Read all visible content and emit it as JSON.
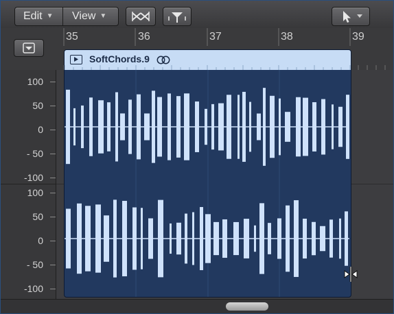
{
  "toolbar": {
    "edit_label": "Edit",
    "view_label": "View",
    "crossfade_icon": "crossfade-icon",
    "catch_icon": "catch-playhead-icon",
    "pointer_icon": "pointer-tool-icon"
  },
  "ruler": {
    "bars": [
      "35",
      "36",
      "37",
      "38",
      "39"
    ]
  },
  "scale": {
    "upper": [
      "100",
      "50",
      "0",
      "- 50",
      "-100"
    ],
    "lower": [
      "100",
      "50",
      "0",
      "- 50",
      "-100"
    ]
  },
  "region": {
    "name": "SoftChords.9",
    "loop_icon": "loop-icon",
    "play_icon": "region-play-icon"
  },
  "colors": {
    "region_header": "#c7dcf5",
    "region_body": "#22395f",
    "waveform": "#cfe2fb"
  }
}
